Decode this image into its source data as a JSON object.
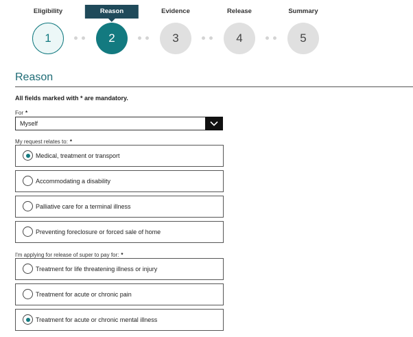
{
  "stepper": {
    "steps": [
      {
        "label": "Eligibility",
        "number": "1",
        "state": "done"
      },
      {
        "label": "Reason",
        "number": "2",
        "state": "active"
      },
      {
        "label": "Evidence",
        "number": "3",
        "state": "todo"
      },
      {
        "label": "Release",
        "number": "4",
        "state": "todo"
      },
      {
        "label": "Summary",
        "number": "5",
        "state": "todo"
      }
    ]
  },
  "section": {
    "title": "Reason",
    "mandatory_note": "All fields marked with * are mandatory."
  },
  "for_field": {
    "label": "For",
    "required_mark": "*",
    "selected": "Myself"
  },
  "relates_to": {
    "label": "My request relates to:",
    "required_mark": "*",
    "options": [
      {
        "label": "Medical, treatment or transport",
        "checked": true
      },
      {
        "label": "Accommodating a disability",
        "checked": false
      },
      {
        "label": "Palliative care for a terminal illness",
        "checked": false
      },
      {
        "label": "Preventing foreclosure or forced sale of home",
        "checked": false
      }
    ]
  },
  "applying_for": {
    "label": "I'm applying for release of super to pay for:",
    "required_mark": "*",
    "options": [
      {
        "label": "Treatment for life threatening illness or injury",
        "checked": false
      },
      {
        "label": "Treatment for acute or chronic pain",
        "checked": false
      },
      {
        "label": "Treatment for acute or chronic mental illness",
        "checked": true
      }
    ]
  },
  "colors": {
    "accent": "#137a80",
    "step_active_label_bg": "#1f4a5a",
    "title": "#1d6b75"
  }
}
